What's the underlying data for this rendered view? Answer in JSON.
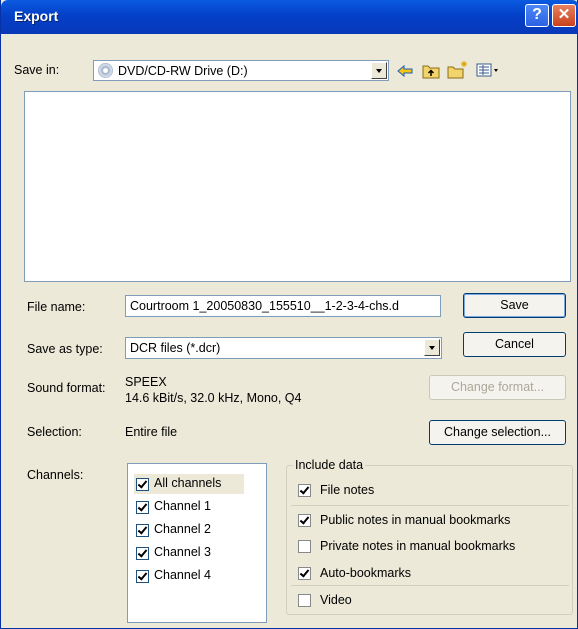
{
  "title": "Export",
  "save_in": {
    "label": "Save in:",
    "value": "DVD/CD-RW Drive (D:)"
  },
  "file_name": {
    "label": "File name:",
    "value": "Courtroom 1_20050830_155510__1-2-3-4-chs.d"
  },
  "save_as_type": {
    "label": "Save as type:",
    "value": "DCR files (*.dcr)"
  },
  "buttons": {
    "save": "Save",
    "cancel": "Cancel",
    "change_format": "Change format...",
    "change_selection": "Change selection..."
  },
  "sound_format": {
    "label": "Sound format:",
    "codec": "SPEEX",
    "details": "14.6 kBit/s, 32.0 kHz, Mono, Q4"
  },
  "selection": {
    "label": "Selection:",
    "value": "Entire file"
  },
  "channels": {
    "label": "Channels:",
    "items": [
      {
        "label": "All channels",
        "checked": true
      },
      {
        "label": "Channel 1",
        "checked": true
      },
      {
        "label": "Channel 2",
        "checked": true
      },
      {
        "label": "Channel 3",
        "checked": true
      },
      {
        "label": "Channel 4",
        "checked": true
      }
    ]
  },
  "include_data": {
    "label": "Include data",
    "items": [
      {
        "label": "File notes",
        "checked": true
      },
      {
        "label": "Public notes in manual bookmarks",
        "checked": true
      },
      {
        "label": "Private notes in manual bookmarks",
        "checked": false
      },
      {
        "label": "Auto-bookmarks",
        "checked": true
      },
      {
        "label": "Video",
        "checked": false
      }
    ]
  }
}
